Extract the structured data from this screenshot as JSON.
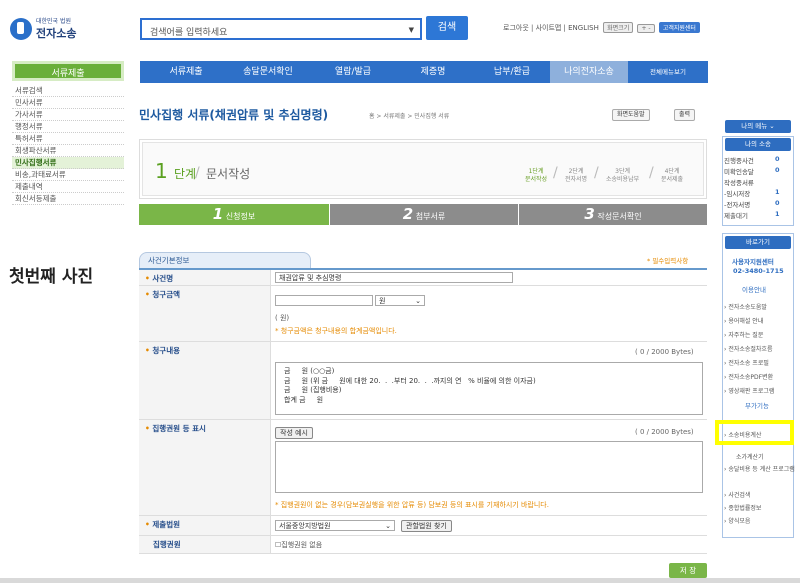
{
  "header": {
    "logo_small": "대한민국 법원",
    "logo_main": "전자소송",
    "search_placeholder": "검색어를 입력하세요",
    "search_button": "검색",
    "util_links": "로그아웃 | 사이트맵 | ENGLISH",
    "util_chip1": "화면크기",
    "util_chip2": "+ -",
    "util_chip3": "고객지원센터"
  },
  "gnb": [
    "서류제출",
    "송달문서확인",
    "열람/발급",
    "제증명",
    "납부/환급",
    "나의전자소송",
    "전체메뉴보기"
  ],
  "left": {
    "title": "서류제출",
    "items": [
      "서류검색",
      "민사서류",
      "가사서류",
      "행정서류",
      "특허서류",
      "회생파산서류",
      "민사집행서류",
      "비송,과태료서류",
      "제출내역",
      "회신서등제출"
    ],
    "active_index": 6
  },
  "photo_label": "첫번째 사진",
  "page": {
    "title": "민사집행 서류(채권압류 및 추심명령)",
    "breadcrumb": "홈 > 서류제출 > 민사집행 서류",
    "help_button": "화면도움말",
    "print_button": "출력"
  },
  "step": {
    "num": "1",
    "unit": "단계",
    "name": "문서작성",
    "steps": [
      {
        "a": "1단계",
        "b": "문서작성"
      },
      {
        "a": "2단계",
        "b": "전자서명"
      },
      {
        "a": "3단계",
        "b": "소송비용납부"
      },
      {
        "a": "4단계",
        "b": "문서제출"
      }
    ]
  },
  "tabs": [
    {
      "num": "1",
      "label": "신청정보"
    },
    {
      "num": "2",
      "label": "첨부서류"
    },
    {
      "num": "3",
      "label": "작성문서확인"
    }
  ],
  "form": {
    "section": "사건기본정보",
    "required_note": "* 필수입력사항",
    "case_label": "사건명",
    "case_value": "채권압류 및 추심명령",
    "amount_label": "청구금액",
    "amount_unit": "원",
    "amount_sub": "( 원)",
    "amount_note": "* 청구금액은 청구내용의 합계금액입니다.",
    "content_label": "청구내용",
    "content_count": "( 0 / 2000 Bytes)",
    "content_text": "금     원 (○○금)\n금     원 (위 금     원에 대한 20.  .  .부터 20.  .  .까지의 연   % 비율에 의한 이자금)\n금     원 (집행비용)\n합계 금     원",
    "exec_label": "집행권원 등 표시",
    "exec_example": "작성 예시",
    "exec_count": "( 0 / 2000 Bytes)",
    "exec_note": "* 집행권원이 없는 경우(담보권실행을 위한 압류 등) 담보권 등의 표시를 기재하시기 바랍니다.",
    "court_label": "제출법원",
    "court_value": "서울중앙지방법원",
    "court_button": "관할법원 찾기",
    "title_label": "집행권원",
    "title_check": "집행권원 없음",
    "save": "저 장"
  },
  "right": {
    "mymenu": "나의 메뉴",
    "mysuit": "나의 소송",
    "lines": [
      {
        "label": "진행중사건",
        "num": "0"
      },
      {
        "label": "미확인송달",
        "num": "0"
      },
      {
        "label": "작성중서류",
        "num": ""
      },
      {
        "label": "-임시저장",
        "num": "1"
      },
      {
        "label": "-전자서명",
        "num": "0"
      },
      {
        "label": "제출대기",
        "num": "1"
      }
    ],
    "goto": "바로가기",
    "center": "사용자지원센터",
    "phone": "02-3480-1715",
    "guide": "이용안내",
    "links": [
      "전자소송도움말",
      "용어해설 안내",
      "자주하는 질문",
      "전자소송절차흐름",
      "전자소송 프로필",
      "전자소송PDF변환",
      "영상재판 프로그램"
    ],
    "extra": "부가기능",
    "links2": [
      "소송비용계산",
      "소가계산기",
      "송달비용 등 계산 프로그램",
      "사건검색",
      "종합법률정보",
      "양식모음"
    ]
  }
}
